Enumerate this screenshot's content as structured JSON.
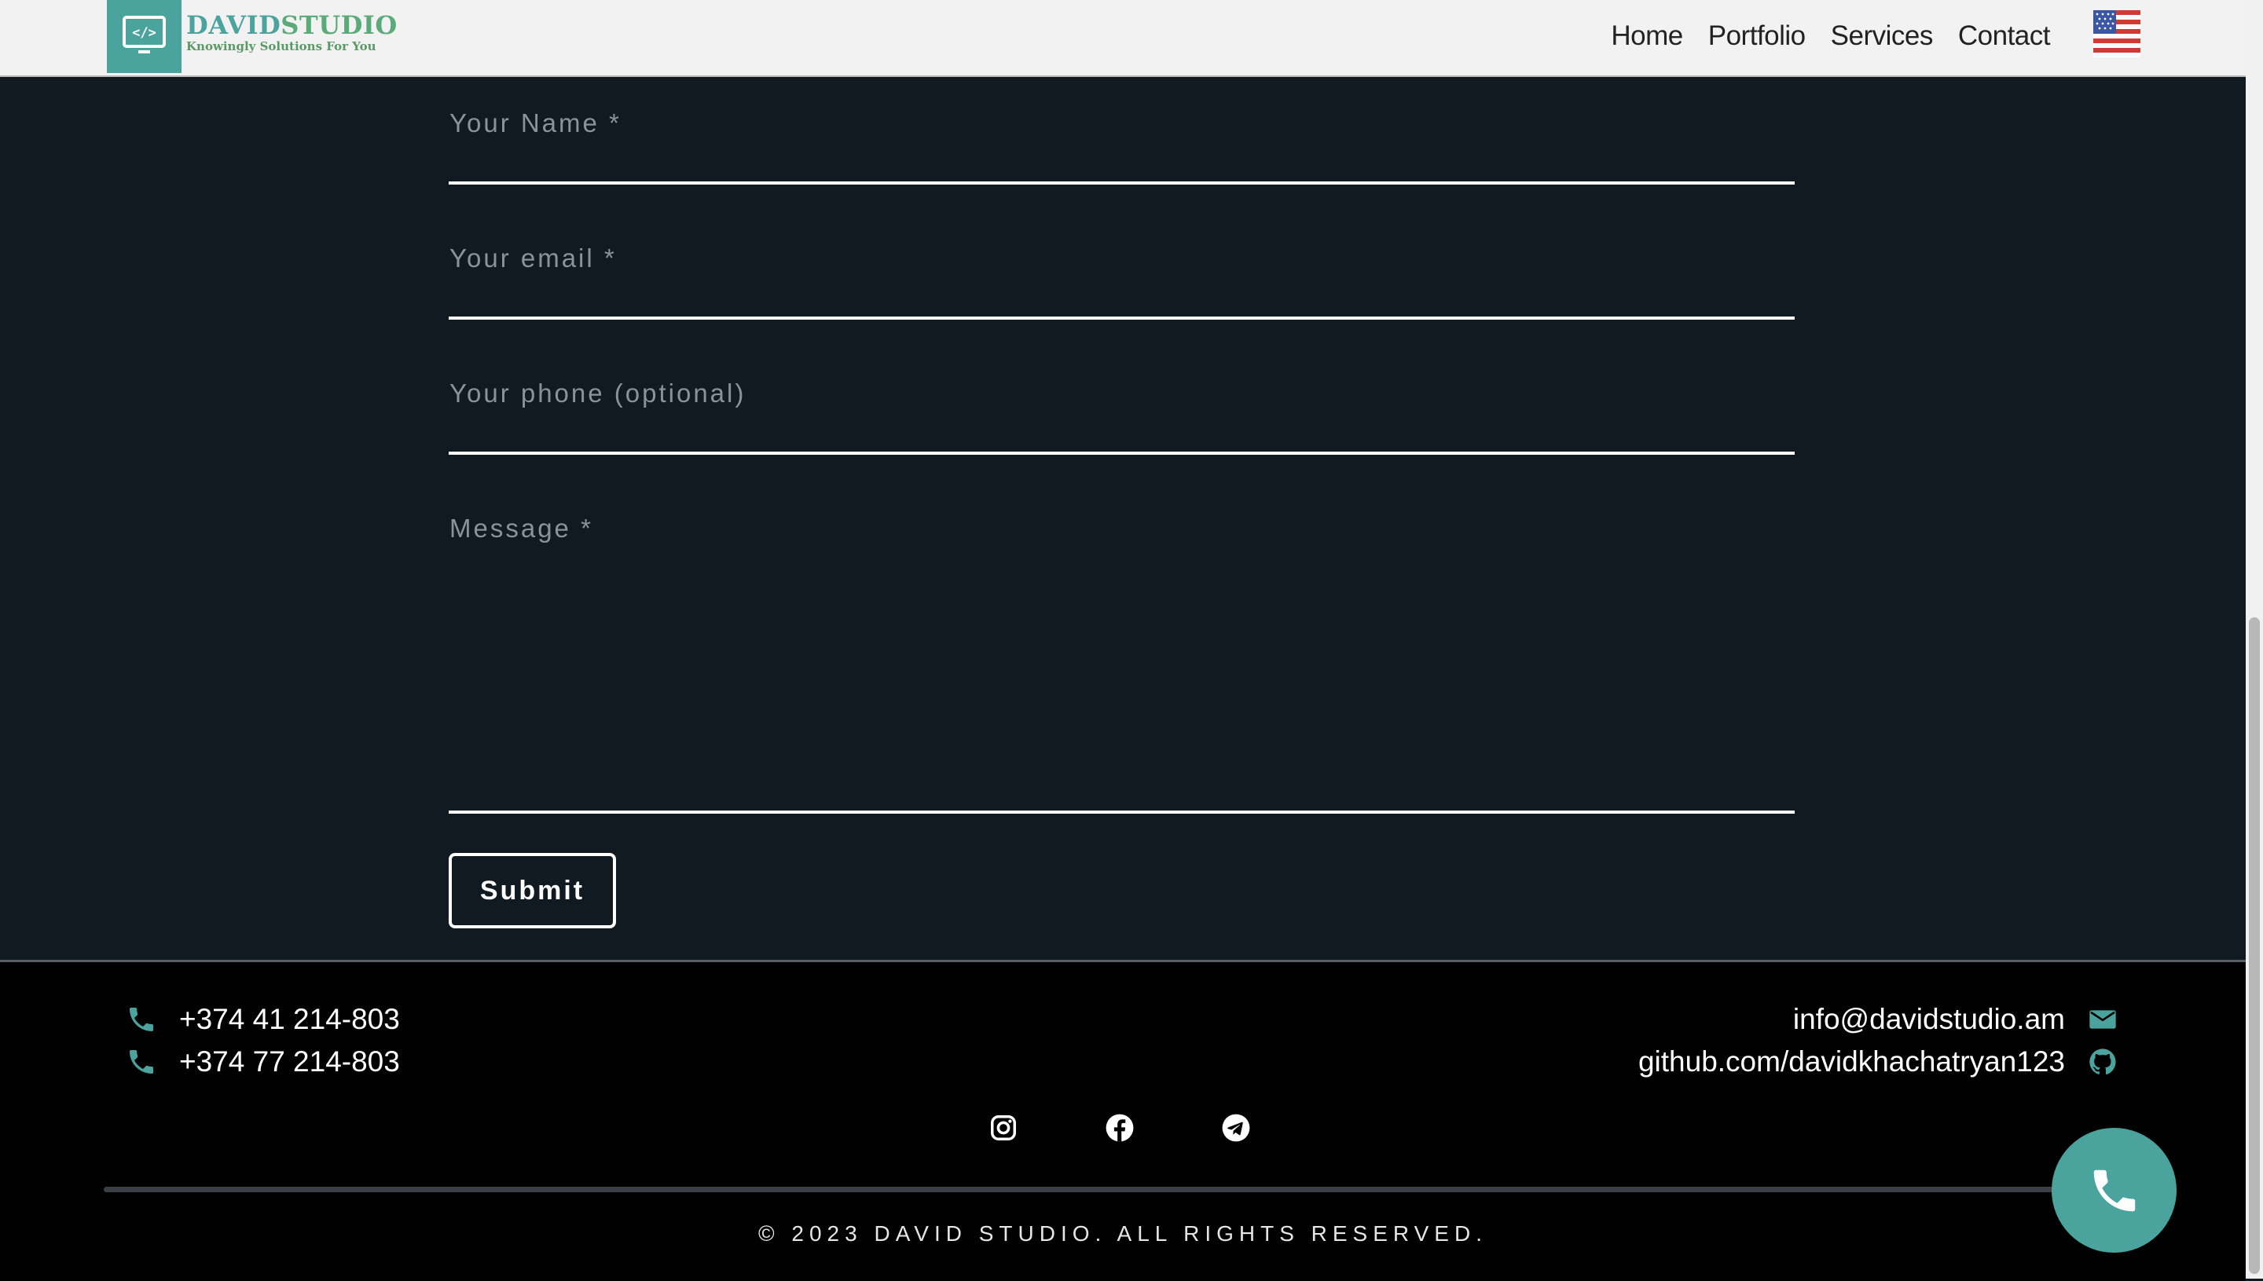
{
  "header": {
    "brand_part1": "DAVID",
    "brand_part2": "STUDIO",
    "tagline": "Knowingly Solutions For You",
    "nav": [
      "Home",
      "Portfolio",
      "Services",
      "Contact"
    ],
    "language_icon": "us-flag-icon"
  },
  "form": {
    "name_label": "Your Name *",
    "email_label": "Your email *",
    "phone_label": "Your phone (optional)",
    "message_label": "Message *",
    "submit_label": "Submit"
  },
  "footer": {
    "phones": [
      "+374 41 214-803",
      "+374 77 214-803"
    ],
    "email": "info@davidstudio.am",
    "github": "github.com/davidkhachatryan123",
    "socials": [
      "instagram-icon",
      "facebook-icon",
      "telegram-icon"
    ],
    "copyright": "© 2023 DAVID STUDIO. ALL RIGHTS RESERVED."
  },
  "colors": {
    "accent": "#4ba39d",
    "page_bg": "#121a21",
    "footer_bg": "#000000",
    "header_bg": "#f2f2f2"
  }
}
